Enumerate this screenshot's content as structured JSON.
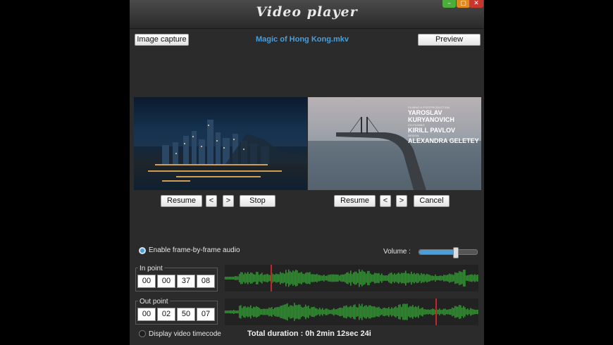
{
  "window": {
    "title": "Video player",
    "controls": {
      "minimize": "–",
      "maximize": "▢",
      "close": "✕"
    }
  },
  "toolbar": {
    "image_capture_label": "Image capture",
    "filename": "Magic of Hong Kong.mkv",
    "preview_label": "Preview"
  },
  "left_player": {
    "resume_label": "Resume",
    "prev_label": "<",
    "next_label": ">",
    "stop_label": "Stop"
  },
  "right_player": {
    "resume_label": "Resume",
    "prev_label": "<",
    "next_label": ">",
    "cancel_label": "Cancel",
    "credits": [
      {
        "role": "FILMING & POSTPRODUCTION",
        "name": "YAROSLAV KURYANOVICH"
      },
      {
        "role": "CO-FILMING",
        "name": "KIRILL PAVLOV"
      },
      {
        "role": "DESIGN",
        "name": "ALEXANDRA GELETEY"
      }
    ]
  },
  "audio": {
    "frame_by_frame_label": "Enable frame-by-frame audio",
    "frame_by_frame_checked": true
  },
  "volume": {
    "label": "Volume :",
    "level": 0.62
  },
  "in_point": {
    "label": "In point",
    "values": [
      "00",
      "00",
      "37",
      "08"
    ],
    "marker_position": 0.18
  },
  "out_point": {
    "label": "Out point",
    "values": [
      "00",
      "02",
      "50",
      "07"
    ],
    "marker_position": 0.83
  },
  "timecode": {
    "label": "Display video timecode",
    "checked": false
  },
  "total_duration": "Total duration : 0h 2min 12sec 24i",
  "colors": {
    "accent": "#4a9edb",
    "marker": "#c1272d",
    "waveform": "#1fa01f",
    "background": "#2b2b2b"
  }
}
